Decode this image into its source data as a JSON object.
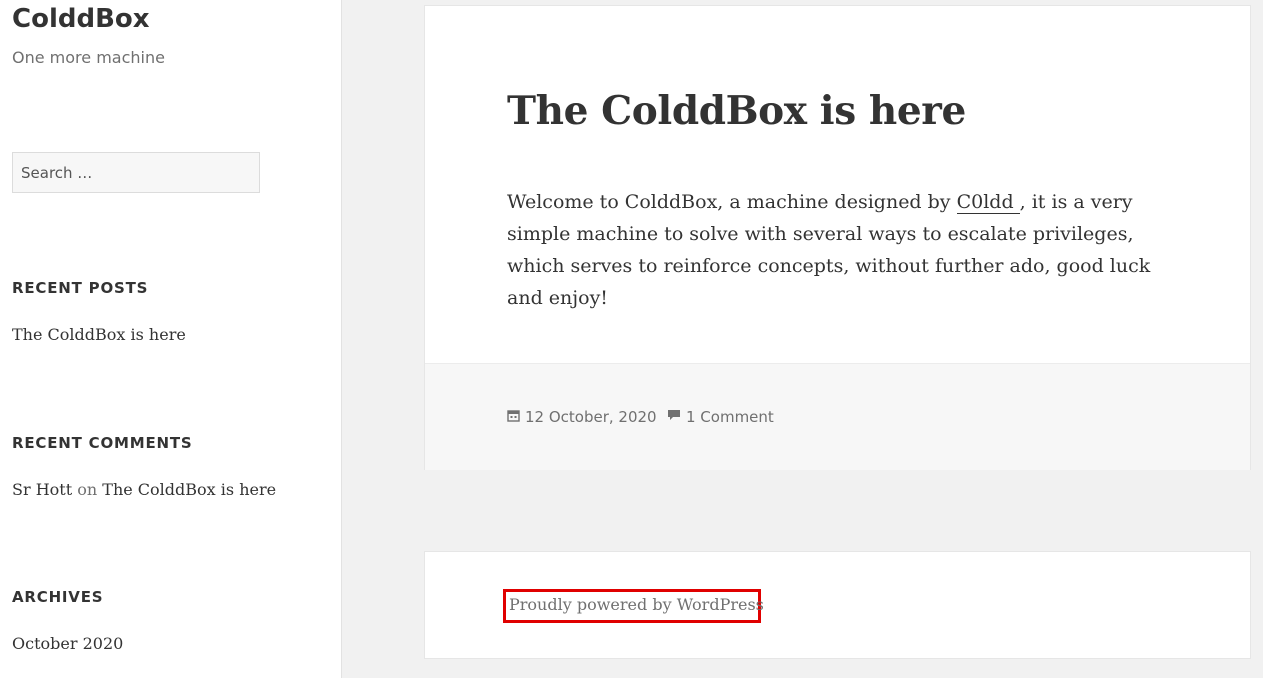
{
  "site": {
    "title": "ColddBox",
    "description": "One more machine"
  },
  "search": {
    "placeholder": "Search …"
  },
  "widgets": {
    "recent_posts": {
      "title": "RECENT POSTS",
      "items": [
        "The ColddBox is here"
      ]
    },
    "recent_comments": {
      "title": "RECENT COMMENTS",
      "items": [
        {
          "author": "Sr Hott",
          "on": "on",
          "post": "The ColddBox is here"
        }
      ]
    },
    "archives": {
      "title": "ARCHIVES",
      "items": [
        "October 2020"
      ]
    }
  },
  "post": {
    "title": "The ColddBox is here",
    "content_before": "Welcome to ColddBox, a machine designed by ",
    "author_link": "C0ldd ",
    "content_after": ", it is a very simple machine to solve with several ways to escalate privileges, which serves to reinforce concepts, without further ado, good luck and enjoy!",
    "date": "12 October, 2020",
    "comments": "1 Comment"
  },
  "footer": {
    "powered_by": "Proudly powered by WordPress",
    "highlight_color": "#e00000"
  },
  "icons": {
    "date": "calendar-icon",
    "comments": "comment-icon"
  }
}
